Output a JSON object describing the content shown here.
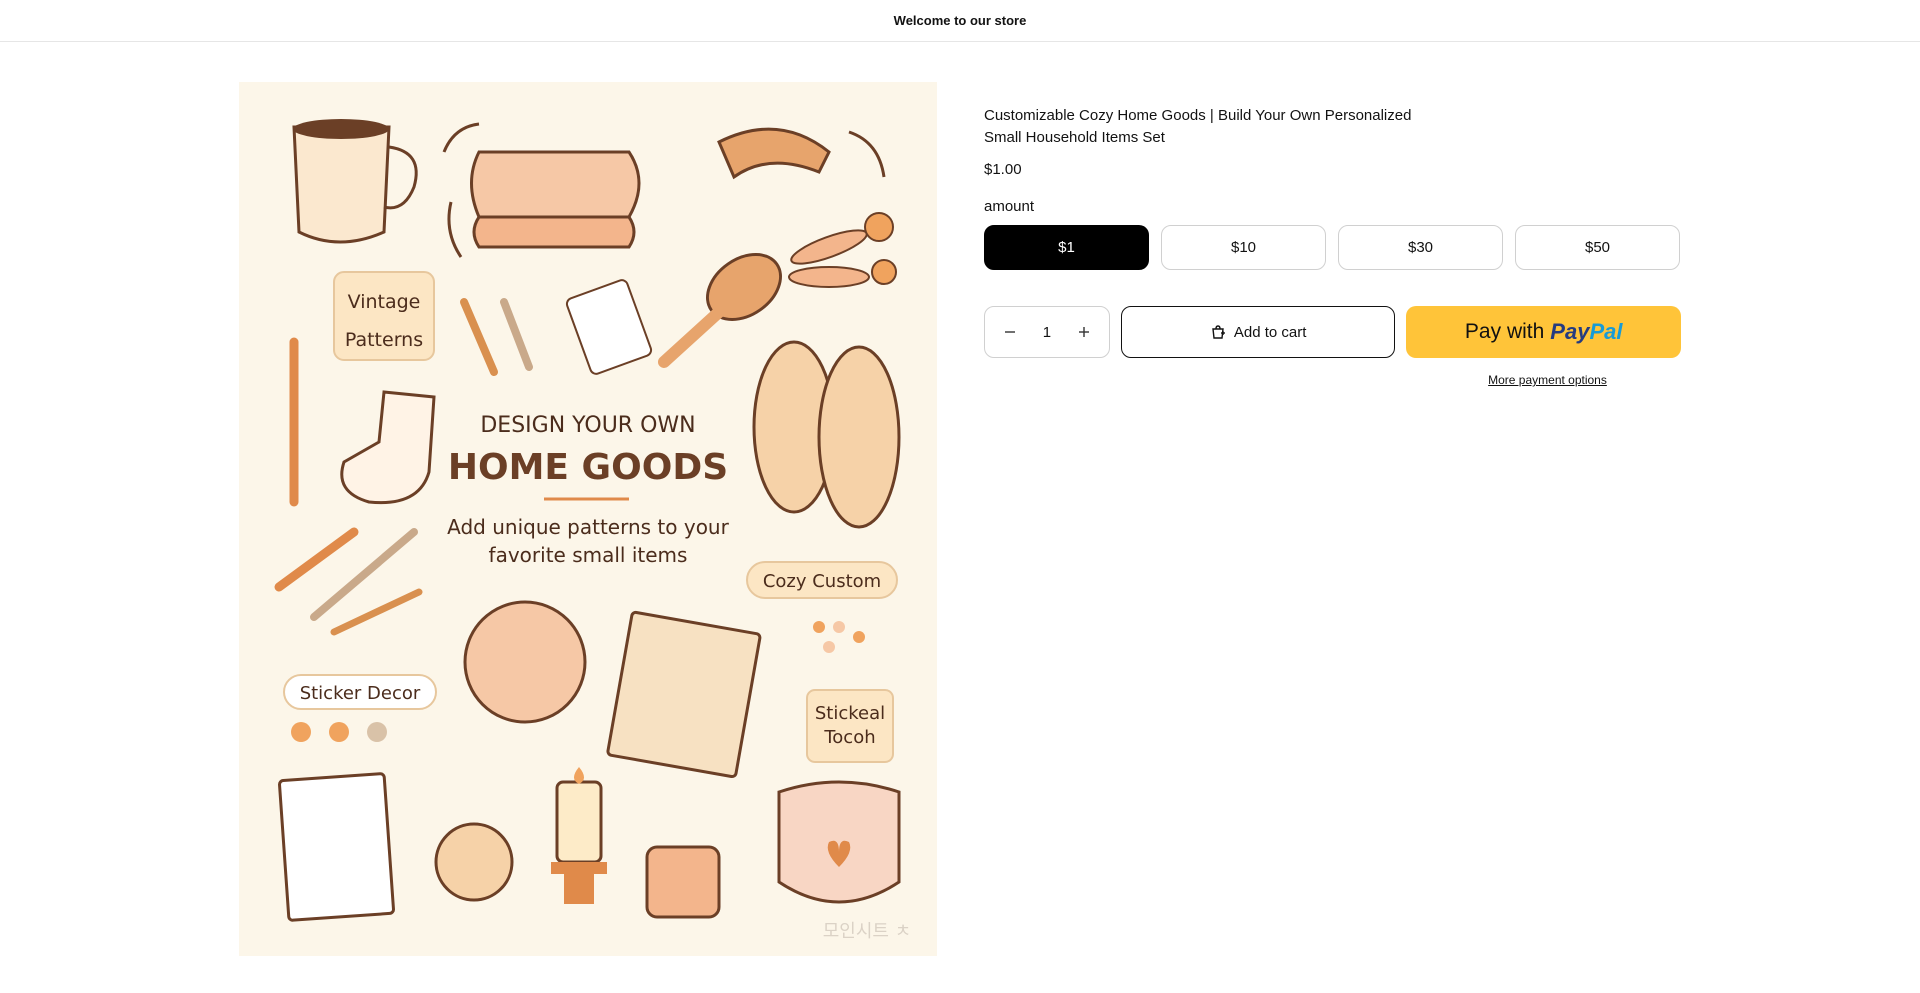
{
  "announcement": {
    "text": "Welcome to our store"
  },
  "product": {
    "title": "Customizable Cozy Home Goods | Build Your Own Personalized Small Household Items Set",
    "price": "$1.00",
    "variant_label": "amount",
    "variants": [
      {
        "label": "$1",
        "selected": true
      },
      {
        "label": "$10",
        "selected": false
      },
      {
        "label": "$30",
        "selected": false
      },
      {
        "label": "$50",
        "selected": false
      }
    ],
    "quantity": "1",
    "add_to_cart": "Add to cart",
    "paypal_prefix": "Pay with",
    "paypal_brand_1": "Pay",
    "paypal_brand_2": "Pal",
    "more_payment": "More payment options"
  },
  "image": {
    "heading_small": "DESIGN YOUR OWN",
    "heading_big": "HOME GOODS",
    "subtitle_1": "Add unique patterns to your",
    "subtitle_2": "favorite small items",
    "tag_vintage_1": "Vintage",
    "tag_vintage_2": "Patterns",
    "tag_cozy": "Cozy Custom",
    "tag_sticker": "Sticker Decor",
    "tag_stickeal_1": "Stickeal",
    "tag_stickeal_2": "Tocoh",
    "watermark": "모인시트 ㅊ",
    "colors": {
      "accent": "#e08a4a",
      "brown": "#6b3f26",
      "cream": "#fcf6e9",
      "peach": "#f6c8a6"
    }
  }
}
